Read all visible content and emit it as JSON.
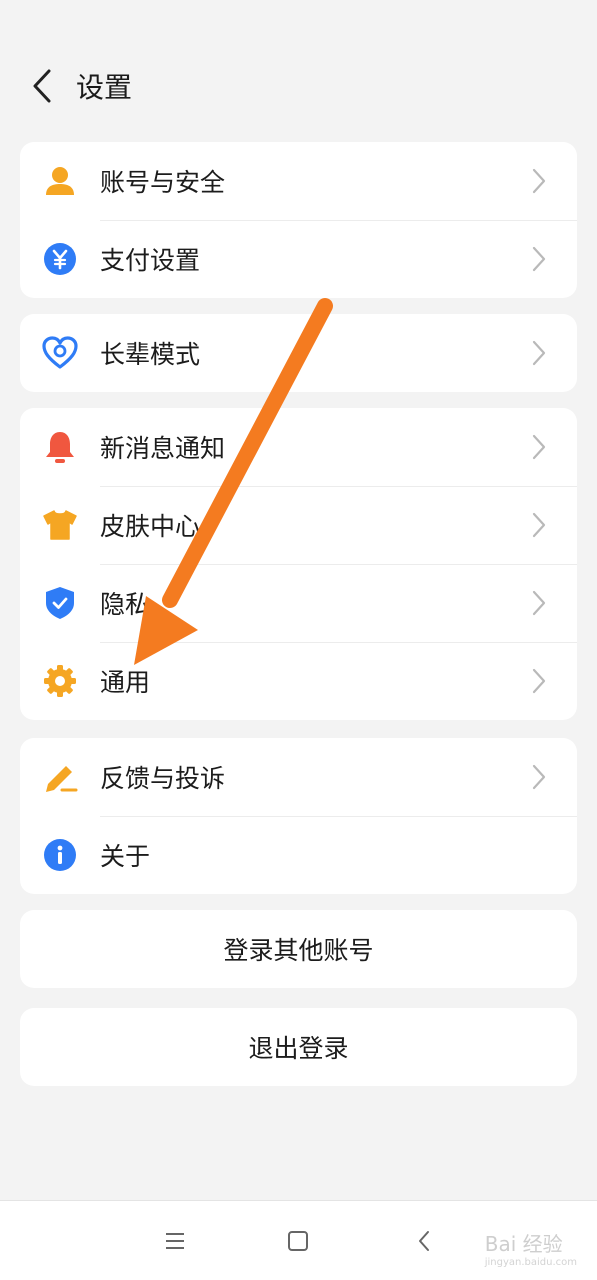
{
  "header": {
    "title": "设置"
  },
  "groups": [
    {
      "items": [
        {
          "label": "账号与安全"
        },
        {
          "label": "支付设置"
        }
      ]
    },
    {
      "items": [
        {
          "label": "长辈模式"
        }
      ]
    },
    {
      "items": [
        {
          "label": "新消息通知"
        },
        {
          "label": "皮肤中心"
        },
        {
          "label": "隐私"
        },
        {
          "label": "通用"
        }
      ]
    },
    {
      "items": [
        {
          "label": "反馈与投诉"
        },
        {
          "label": "关于"
        }
      ]
    }
  ],
  "buttons": {
    "switch_account": "登录其他账号",
    "logout": "退出登录"
  },
  "icons": {
    "account": "person-icon",
    "payment": "yuan-icon",
    "elder": "heart-icon",
    "notification": "bell-icon",
    "skin": "tshirt-icon",
    "privacy": "shield-icon",
    "general": "gear-icon",
    "feedback": "pencil-icon",
    "about": "info-icon"
  },
  "colors": {
    "background": "#f3f3f3",
    "card": "#ffffff",
    "orange": "#f5a623",
    "blue": "#2f7cf6",
    "red": "#f0573f",
    "arrow": "#f47b20"
  },
  "watermark": {
    "text": "Bai 经验",
    "sub": "jingyan.baidu.com"
  }
}
